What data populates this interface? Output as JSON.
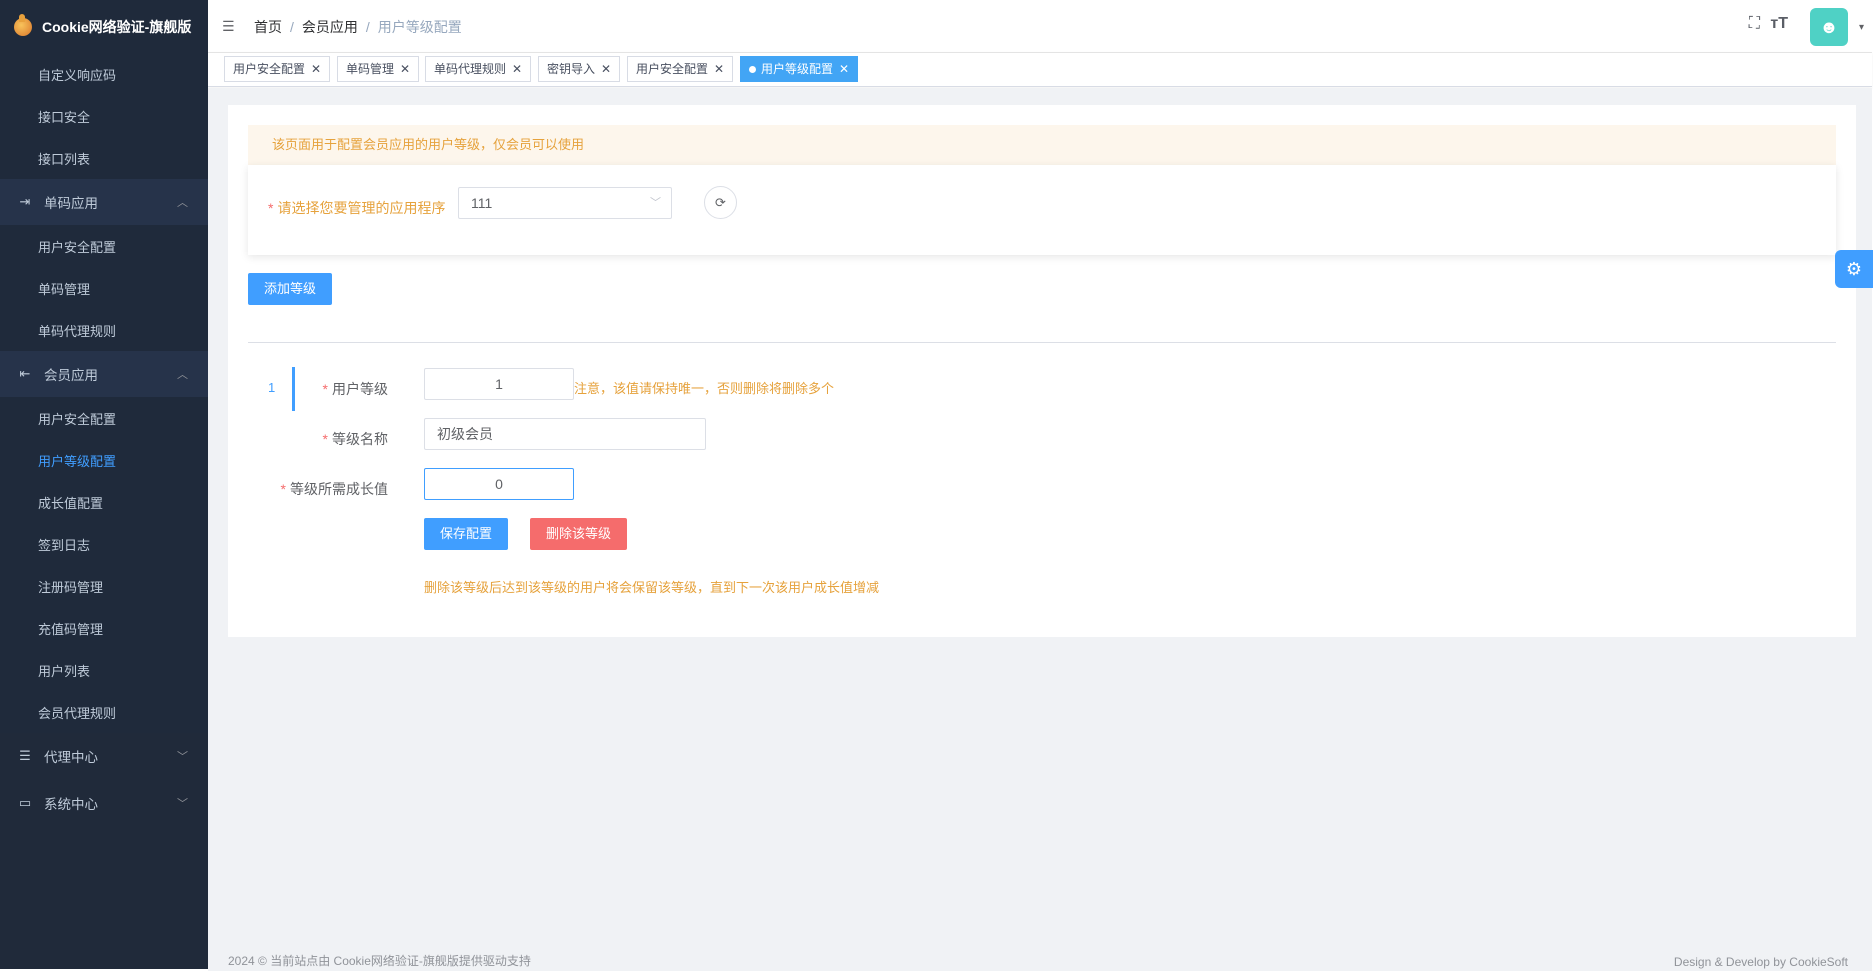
{
  "app": {
    "title": "Cookie网络验证-旗舰版"
  },
  "sidebar": {
    "top_items": [
      {
        "label": "自定义响应码"
      },
      {
        "label": "接口安全"
      },
      {
        "label": "接口列表"
      }
    ],
    "groups": [
      {
        "label": "单码应用",
        "icon": "login-icon",
        "expanded": true,
        "items": [
          {
            "label": "用户安全配置"
          },
          {
            "label": "单码管理"
          },
          {
            "label": "单码代理规则"
          }
        ]
      },
      {
        "label": "会员应用",
        "icon": "logout-icon",
        "expanded": true,
        "items": [
          {
            "label": "用户安全配置"
          },
          {
            "label": "用户等级配置",
            "active": true
          },
          {
            "label": "成长值配置"
          },
          {
            "label": "签到日志"
          },
          {
            "label": "注册码管理"
          },
          {
            "label": "充值码管理"
          },
          {
            "label": "用户列表"
          },
          {
            "label": "会员代理规则"
          }
        ]
      },
      {
        "label": "代理中心",
        "icon": "tree-icon",
        "expanded": false
      },
      {
        "label": "系统中心",
        "icon": "monitor-icon",
        "expanded": false
      }
    ]
  },
  "header": {
    "breadcrumb": [
      "首页",
      "会员应用",
      "用户等级配置"
    ]
  },
  "tags": [
    {
      "label": "用户安全配置"
    },
    {
      "label": "单码管理"
    },
    {
      "label": "单码代理规则"
    },
    {
      "label": "密钥导入"
    },
    {
      "label": "用户安全配置"
    },
    {
      "label": "用户等级配置",
      "active": true
    }
  ],
  "main": {
    "alert": "该页面用于配置会员应用的用户等级，仅会员可以使用",
    "app_select": {
      "label": "请选择您要管理的应用程序",
      "value": "111"
    },
    "add_button": "添加等级",
    "level": {
      "index": "1",
      "level_label": "用户等级",
      "level_value": "1",
      "level_note": "注意，该值请保持唯一，否则删除将删除多个",
      "name_label": "等级名称",
      "name_value": "初级会员",
      "growth_label": "等级所需成长值",
      "growth_value": "0",
      "save_button": "保存配置",
      "delete_button": "删除该等级",
      "delete_note": "删除该等级后达到该等级的用户将会保留该等级，直到下一次该用户成长值增减"
    }
  },
  "footer": {
    "left": "2024 © 当前站点由 Cookie网络验证-旗舰版提供驱动支持",
    "right": "Design & Develop by CookieSoft"
  },
  "colors": {
    "primary": "#409eff",
    "danger": "#f56c6c",
    "warning": "#e6a23c",
    "sidebar": "#202a3a"
  }
}
